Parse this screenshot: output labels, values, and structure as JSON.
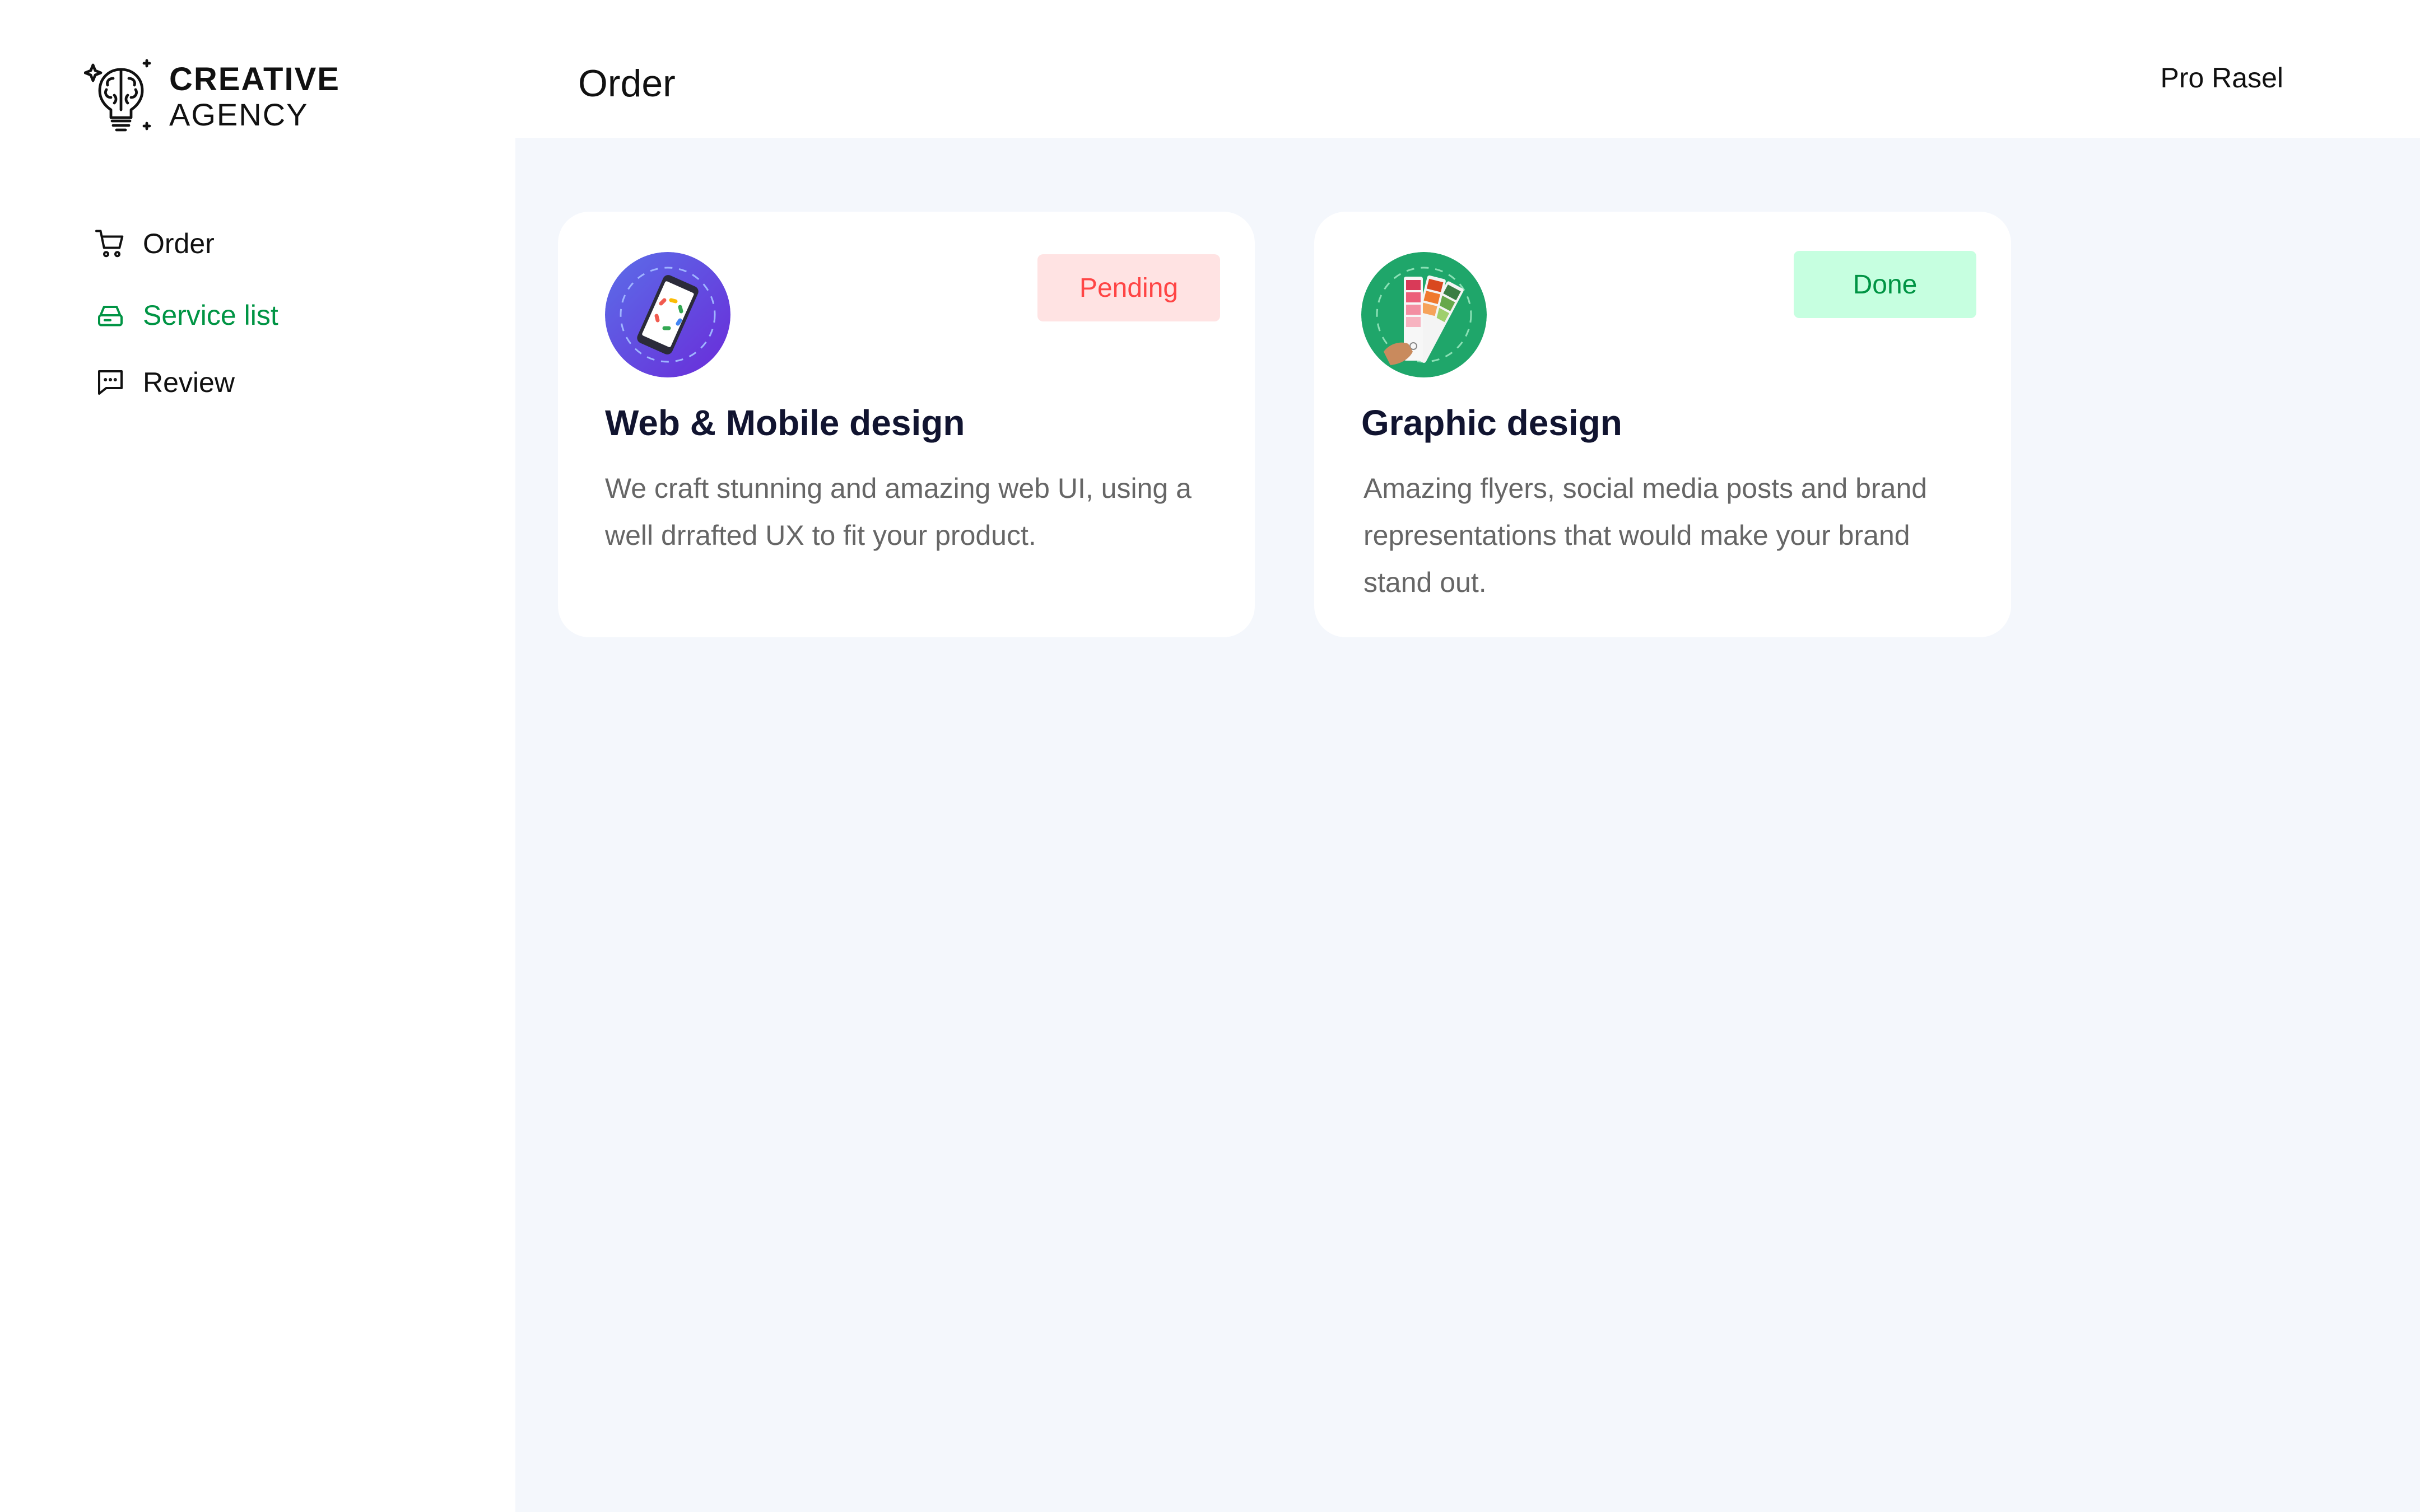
{
  "brand": {
    "line1": "CREATIVE",
    "line2": "AGENCY",
    "icon": "brain-bulb-icon"
  },
  "sidebar": {
    "items": [
      {
        "label": "Order",
        "icon": "cart-icon",
        "active": false
      },
      {
        "label": "Service list",
        "icon": "drive-icon",
        "active": true
      },
      {
        "label": "Review",
        "icon": "chat-icon",
        "active": false
      }
    ]
  },
  "header": {
    "title": "Order",
    "user": "Pro Rasel"
  },
  "orders": [
    {
      "title": "Web & Mobile design",
      "description": "We craft stunning and amazing web UI, using a well drrafted UX to fit your product.",
      "status": "Pending",
      "icon": "mobile-phone-icon"
    },
    {
      "title": "Graphic design",
      "description": "Amazing flyers, social media posts and brand representations that would make your brand stand out.",
      "status": "Done",
      "icon": "color-palette-icon"
    }
  ],
  "colors": {
    "accent": "#009444",
    "pending_bg": "#ffe3e3",
    "pending_text": "#ff4545",
    "done_bg": "#c6ffe0",
    "done_text": "#009444",
    "main_bg": "#f4f7fc"
  }
}
